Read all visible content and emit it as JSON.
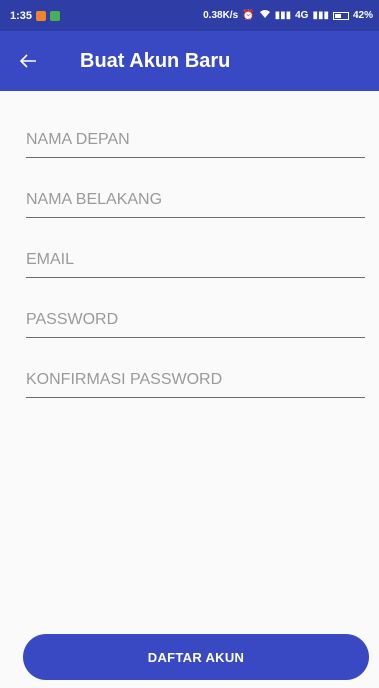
{
  "status_bar": {
    "time": "1:35",
    "net_speed": "0.38K/s",
    "network": "4G",
    "battery": "42%",
    "icons": [
      "notification-orange-icon",
      "notification-green-icon",
      "alarm-icon",
      "wifi-icon",
      "signal-icon",
      "battery-icon"
    ]
  },
  "app_bar": {
    "title": "Buat Akun Baru",
    "back_icon": "arrow-back-icon",
    "color": "#3949c4"
  },
  "form": {
    "first_name_placeholder": "NAMA DEPAN",
    "last_name_placeholder": "NAMA BELAKANG",
    "email_placeholder": "EMAIL",
    "password_placeholder": "PASSWORD",
    "confirm_password_placeholder": "KONFIRMASI PASSWORD"
  },
  "submit": {
    "label": "DAFTAR AKUN"
  }
}
